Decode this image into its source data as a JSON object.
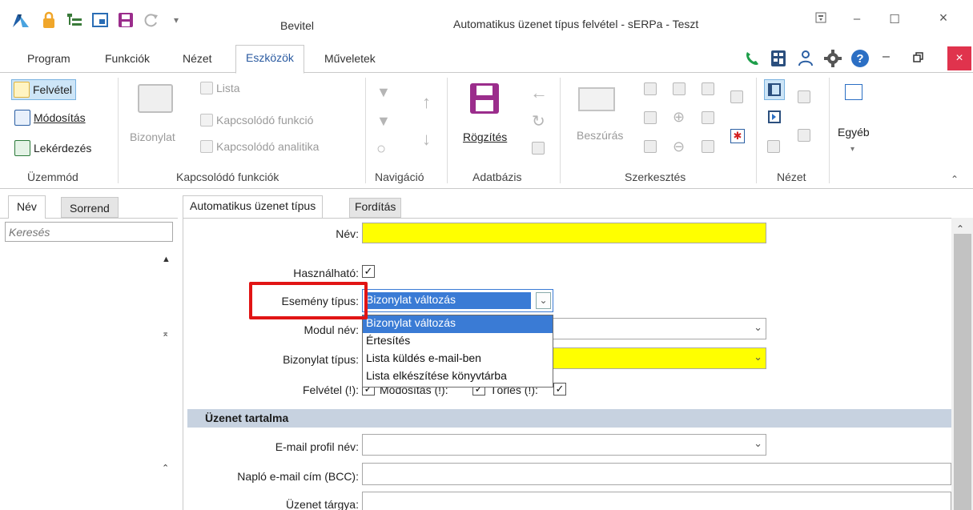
{
  "titlebar": {
    "center_label": "Bevitel",
    "window_title": "Automatikus üzenet típus felvétel - sERPa - Teszt"
  },
  "menu": {
    "tabs": [
      {
        "label": "Program"
      },
      {
        "label": "Funkciók"
      },
      {
        "label": "Nézet"
      },
      {
        "label": "Eszközök"
      },
      {
        "label": "Műveletek"
      }
    ]
  },
  "ribbon": {
    "uzemmod": {
      "group": "Üzemmód",
      "felvetel": "Felvétel",
      "modositas": "Módosítás",
      "lekerdezes": "Lekérdezés"
    },
    "kapcsolodo": {
      "group": "Kapcsolódó funkciók",
      "bizonylat": "Bizonylat",
      "lista": "Lista",
      "funkcio": "Kapcsolódó funkció",
      "analitika": "Kapcsolódó analitika"
    },
    "navigacio": {
      "group": "Navigáció"
    },
    "adatbazis": {
      "group": "Adatbázis",
      "rogzites": "Rögzítés"
    },
    "szerkesztes": {
      "group": "Szerkesztés",
      "beszuras": "Beszúrás"
    },
    "nezet": {
      "group": "Nézet"
    },
    "egyeb": {
      "label": "Egyéb"
    }
  },
  "left": {
    "tab_active": "Név",
    "tab_inactive": "Sorrend",
    "search_placeholder": "Keresés"
  },
  "right_tabs": {
    "active": "Automatikus üzenet típus",
    "inactive": "Fordítás"
  },
  "form": {
    "nev_label": "Név:",
    "hasznalhato_label": "Használható:",
    "esemeny_label": "Esemény típus:",
    "esemeny_value": "Bizonylat változás",
    "modul_label": "Modul név:",
    "bizonylat_label": "Bizonylat típus:",
    "felvetel_label": "Felvétel (!):",
    "modositas_label": "Módosítás (!):",
    "torles_label": "Törlés (!):",
    "section_title": "Üzenet tartalma",
    "email_profil_label": "E-mail profil név:",
    "naplo_label": "Napló e-mail cím (BCC):",
    "targy_label": "Üzenet tárgya:"
  },
  "dropdown": {
    "options": [
      "Bizonylat változás",
      "Értesítés",
      "Lista küldés e-mail-ben",
      "Lista elkészítése könyvtárba"
    ]
  },
  "colors": {
    "required_field": "#ffff00",
    "selection": "#3a7bd5",
    "highlight_box": "#e11414",
    "section_band": "#c7d2e0"
  }
}
